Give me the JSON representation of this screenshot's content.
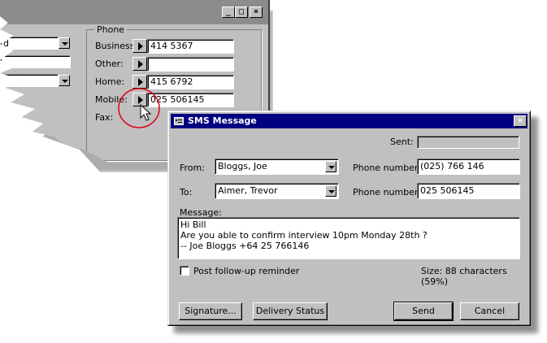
{
  "background_window": {
    "title_buttons": [
      "_",
      "□",
      "×"
    ],
    "left_fields": [
      "d",
      "",
      ""
    ],
    "phone_group": {
      "title": "Phone",
      "rows": [
        {
          "label": "Business:",
          "value": "414 5367"
        },
        {
          "label": "Other:",
          "value": ""
        },
        {
          "label": "Home:",
          "value": "415 6792"
        },
        {
          "label": "Mobile:",
          "value": "025 506145"
        },
        {
          "label": "Fax:",
          "value": ""
        }
      ]
    }
  },
  "sms_dialog": {
    "title": "SMS Message",
    "close_glyph": "×",
    "sent_label": "Sent:",
    "sent_value": "",
    "from_label": "From:",
    "from_value": "Bloggs, Joe",
    "from_phone_label": "Phone number:",
    "from_phone_value": "(025) 766 146",
    "to_label": "To:",
    "to_value": "Aimer, Trevor",
    "to_phone_label": "Phone number:",
    "to_phone_value": "025 506145",
    "message_label": "Message:",
    "message_text": "Hi Bill\nAre you able to confirm interview 10pm Monday 28th ?\n-- Joe Bloggs +64 25 766146",
    "reminder_label": "Post follow-up reminder",
    "size_text": "Size: 88 characters (59%)",
    "buttons": {
      "signature": "Signature...",
      "delivery_status": "Delivery Status",
      "send": "Send",
      "cancel": "Cancel"
    }
  },
  "colors": {
    "dialog_title_bar": "#000080",
    "face": "#c0c0c0",
    "highlight_circle": "#e0001b"
  }
}
